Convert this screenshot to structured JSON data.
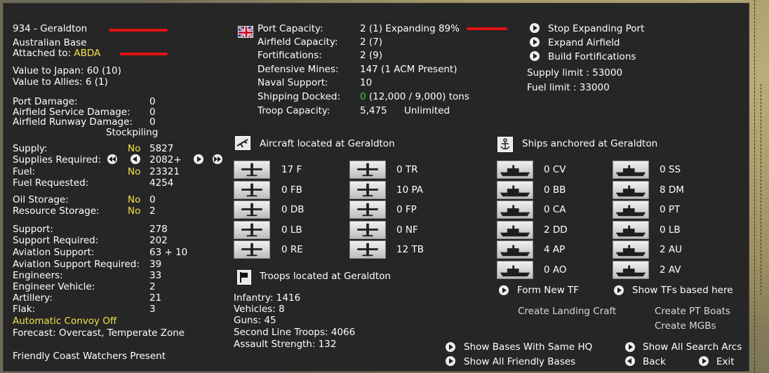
{
  "base": {
    "title": "934 - Geraldton",
    "type": "Australian Base",
    "attached_label": "Attached to:",
    "attached_value": "ABDA",
    "value_japan": "Value to Japan: 60 (10)",
    "value_allies": "Value to Allies: 6 (1)"
  },
  "damage": [
    {
      "label": "Port Damage:",
      "value": "0"
    },
    {
      "label": "Airfield Service Damage:",
      "value": "0"
    },
    {
      "label": "Airfield Runway Damage:",
      "value": "0"
    }
  ],
  "stockpiling_label": "Stockpiling",
  "supply": {
    "supply_label": "Supply:",
    "supply_flag": "No",
    "supply_value": "5827",
    "req_label": "Supplies Required:",
    "req_value": "2082+",
    "fuel_label": "Fuel:",
    "fuel_flag": "No",
    "fuel_value": "23321",
    "fuel_req_label": "Fuel Requested:",
    "fuel_req_value": "4254",
    "oil_label": "Oil Storage:",
    "oil_flag": "No",
    "oil_value": "0",
    "res_label": "Resource Storage:",
    "res_flag": "No",
    "res_value": "2"
  },
  "support": [
    {
      "label": "Support:",
      "value": "278"
    },
    {
      "label": "Support Required:",
      "value": "202"
    },
    {
      "label": "Aviation Support:",
      "value": "63 + 10"
    },
    {
      "label": "Aviation Support Required:",
      "value": "39"
    },
    {
      "label": "Engineers:",
      "value": "33"
    },
    {
      "label": "Engineer Vehicle:",
      "value": "2"
    },
    {
      "label": "Artillery:",
      "value": "21"
    },
    {
      "label": "Flak:",
      "value": "3"
    }
  ],
  "convoy": "Automatic Convoy Off",
  "forecast": "Forecast: Overcast, Temperate Zone",
  "coastwatchers": "Friendly Coast Watchers Present",
  "port": [
    {
      "label": "Port Capacity:",
      "value": "2 (1) Expanding 89%"
    },
    {
      "label": "Airfield Capacity:",
      "value": "2 (7)"
    },
    {
      "label": "Fortifications:",
      "value": "2 (9)"
    },
    {
      "label": "Defensive Mines:",
      "value": "147 (1 ACM Present)"
    },
    {
      "label": "Naval Support:",
      "value": "10"
    },
    {
      "label": "Shipping Docked:",
      "value_green": "0",
      "value": "(12,000 / 9,000) tons"
    },
    {
      "label": "Troop Capacity:",
      "value": "5,475",
      "value2": "Unlimited"
    }
  ],
  "actions": {
    "stop_expanding": "Stop Expanding Port",
    "expand_airfield": "Expand Airfield",
    "build_forts": "Build Fortifications",
    "supply_limit": "Supply limit : 53000",
    "fuel_limit": "Fuel limit : 33000"
  },
  "aircraft": {
    "header": "Aircraft located at Geraldton",
    "left": [
      "17 F",
      "0 FB",
      "0 DB",
      "0 LB",
      "0 RE"
    ],
    "right": [
      "0 TR",
      "10 PA",
      "0 FP",
      "0 NF",
      "12 TB"
    ]
  },
  "ships": {
    "header": "Ships anchored at Geraldton",
    "left": [
      "0 CV",
      "0 BB",
      "0 CA",
      "2 DD",
      "4 AP",
      "0 AO"
    ],
    "right": [
      "0 SS",
      "8 DM",
      "0 PT",
      "0 LB",
      "2 AU",
      "2 AV"
    ],
    "form_tf": "Form New TF",
    "show_tfs": "Show TFs based here",
    "landing_craft": "Create Landing Craft",
    "pt_boats": "Create PT Boats",
    "mgbs": "Create MGBs"
  },
  "troops": {
    "header": "Troops located at Geraldton",
    "lines": [
      "Infantry: 1416",
      "Vehicles: 8",
      "Guns: 45",
      "Second Line Troops: 4066",
      "Assault Strength: 132"
    ]
  },
  "bottom": {
    "same_hq": "Show Bases With Same HQ",
    "all_friendly": "Show All Friendly Bases",
    "search_arcs": "Show All Search Arcs",
    "back": "Back",
    "exit": "Exit"
  },
  "colors": {
    "highlight": "#f2e24a",
    "green": "#2ed14a",
    "panel": "#262626",
    "annotation": "#e21212"
  }
}
